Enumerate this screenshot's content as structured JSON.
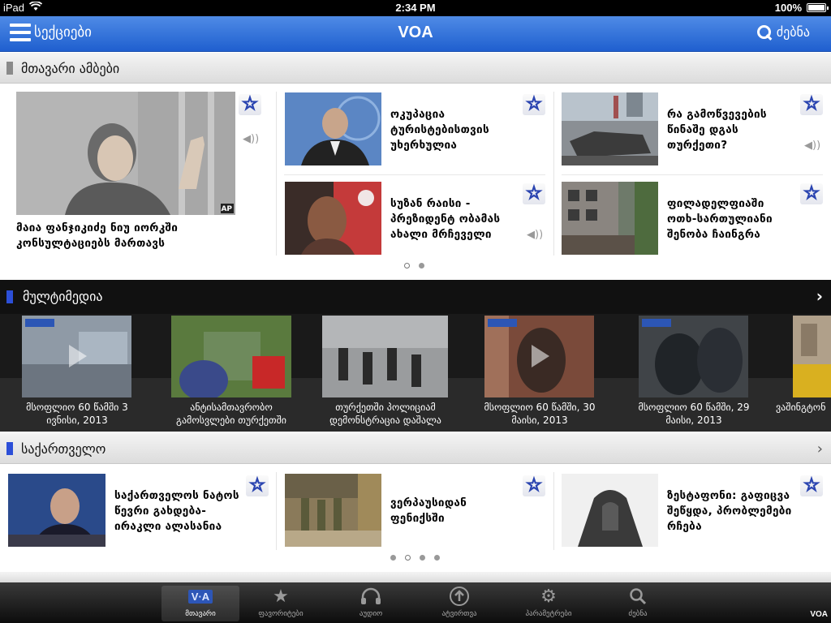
{
  "statusbar": {
    "device": "iPad",
    "time": "2:34 PM",
    "battery": "100%"
  },
  "navbar": {
    "menu_label": "სექციები",
    "title": "VOA",
    "search_label": "ძებნა"
  },
  "top_stories": {
    "header": "მთავარი ამბები",
    "lead": {
      "headline": "მაია ფანჯიკიძე ნიუ იორკში კონსულტაციებს მართავს",
      "credit": "AP"
    },
    "cards": [
      {
        "headline": "ოკუპაცია ტურისტებისთვის უხერხულია"
      },
      {
        "headline": "რა გამოწვევების წინაშე დგას თურქეთი?"
      },
      {
        "headline": "სუზან რაისი - პრეზიდენტ ობამას ახალი მრჩეველი"
      },
      {
        "headline": "ფილადელფიაში ოთხ-სართულიანი შენობა ჩაინგრა"
      }
    ]
  },
  "multimedia": {
    "header": "მულტიმედია",
    "items": [
      {
        "caption1": "მსოფლიო 60 წამში 3",
        "caption2": "ივნისი, 2013"
      },
      {
        "caption1": "ანტისამთავრობო",
        "caption2": "გამოსვლები თურქეთში"
      },
      {
        "caption1": "თურქეთში პოლიციამ",
        "caption2": "დემონსტრაცია დაშალა"
      },
      {
        "caption1": "მსოფლიო 60 წამში, 30",
        "caption2": "მაისი, 2013"
      },
      {
        "caption1": "მსოფლიო 60 წამში, 29",
        "caption2": "მაისი, 2013"
      },
      {
        "caption1": "ვაშინგტონ",
        "caption2": ""
      }
    ]
  },
  "georgia": {
    "header": "საქართველო",
    "cards": [
      {
        "headline": "საქართველოს ნატოს წევრი გახდება- ირაკლი ალასანია"
      },
      {
        "headline": "ვერპაუსიდან ფენიქსში"
      },
      {
        "headline": "ზესტაფონი: გაფიცვა შეწყდა, პრობლემები რჩება"
      }
    ]
  },
  "tabbar": {
    "tabs": [
      {
        "label": "მთავარი",
        "icon": "voa-logo-icon"
      },
      {
        "label": "ფავორიტები",
        "icon": "star-icon"
      },
      {
        "label": "აუდიო",
        "icon": "headphones-icon"
      },
      {
        "label": "ატვირთვა",
        "icon": "upload-icon"
      },
      {
        "label": "პარამეტრები",
        "icon": "gear-icon"
      },
      {
        "label": "ძებნა",
        "icon": "search-icon"
      }
    ],
    "brand": "VOA"
  },
  "colors": {
    "nav_blue": "#2f6fd9",
    "star_blue": "#2a44b0",
    "mm_bg": "#1a1a1a"
  }
}
